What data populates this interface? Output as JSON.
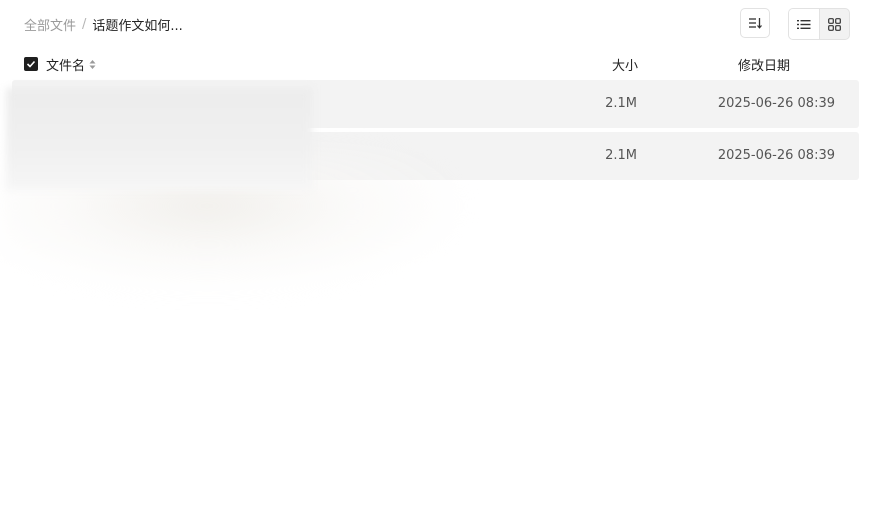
{
  "breadcrumb": {
    "root": "全部文件",
    "separator": "/",
    "current": "话题作文如何..."
  },
  "toolbar": {
    "sort_icon": "sort-descending-icon",
    "list_view_icon": "list-view-icon",
    "grid_view_icon": "grid-view-icon",
    "active_view": "list"
  },
  "table": {
    "headers": {
      "name": "文件名",
      "size": "大小",
      "date": "修改日期"
    },
    "select_all_checked": true,
    "rows": [
      {
        "size": "2.1M",
        "date": "2025-06-26 08:39"
      },
      {
        "size": "2.1M",
        "date": "2025-06-26 08:39"
      }
    ]
  },
  "colors": {
    "row_background": "#f3f3f3",
    "muted_text": "#9a9a9a",
    "checkbox": "#1f1f1f"
  }
}
